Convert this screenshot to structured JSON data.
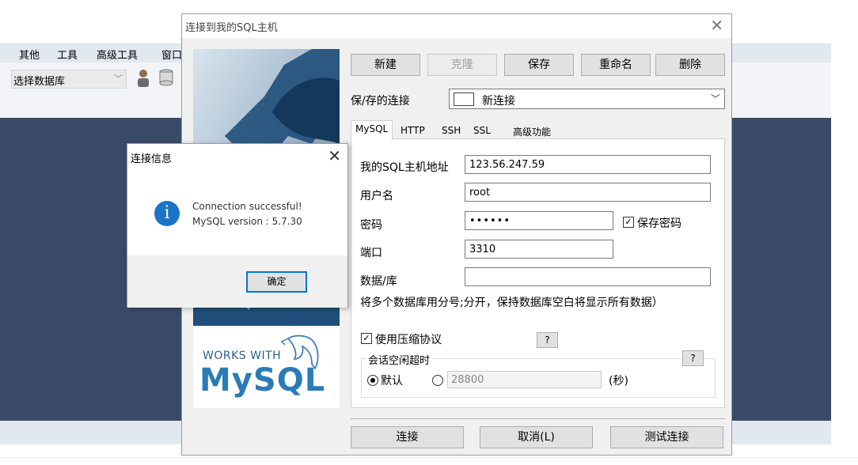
{
  "app": {
    "menu": [
      "其他",
      "工具",
      "高级工具",
      "窗口"
    ],
    "db_select": "选择数据库"
  },
  "dialog": {
    "title": "连接到我的SQL主机",
    "buttons": {
      "new": "新建",
      "clone": "克隆",
      "save": "保存",
      "rename": "重命名",
      "delete": "删除"
    },
    "saved_label": "保/存的连接",
    "saved_value": "新连接",
    "tabs": [
      "MySQL",
      "HTTP",
      "SSH",
      "SSL",
      "高级功能"
    ],
    "fields": {
      "host_label": "我的SQL主机地址",
      "host_value": "123.56.247.59",
      "user_label": "用户名",
      "user_value": "root",
      "password_label": "密码",
      "password_value": "••••••",
      "save_password_label": "保存密码",
      "port_label": "端口",
      "port_value": "3310",
      "db_label": "数据/库",
      "db_value": "",
      "db_hint": "将多个数据库用分号;分开，保持数据库空白将显示所有数据）"
    },
    "compression_label": "使用压缩协议",
    "help_label": "?",
    "timeout": {
      "label": "会话空闲超时",
      "default_label": "默认",
      "value": "28800",
      "unit": "(秒)"
    },
    "footer": {
      "connect": "连接",
      "cancel": "取消(L)",
      "test": "测试连接"
    },
    "banner": {
      "works_with": "WORKS WITH",
      "logo": "MySQL"
    }
  },
  "info": {
    "title": "连接信息",
    "line1": "Connection successful!",
    "line2": "MySQL version : 5.7.30",
    "ok": "确定"
  }
}
